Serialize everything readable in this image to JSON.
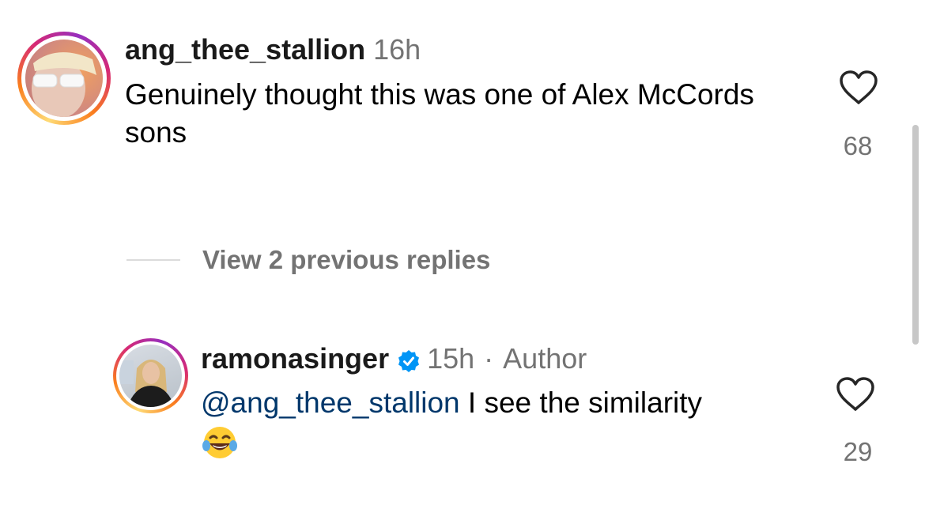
{
  "comments": [
    {
      "username": "ang_thee_stallion",
      "time": "16h",
      "text": "Genuinely thought this was one of Alex McCords sons",
      "likes": "68",
      "avatar_icon": "sunglasses-woman-avatar"
    }
  ],
  "view_replies": {
    "label": "View 2 previous replies"
  },
  "reply": {
    "username": "ramonasinger",
    "verified": true,
    "time": "15h",
    "separator": "·",
    "author_label": "Author",
    "mention": "@ang_thee_stallion",
    "text": "I see the similarity",
    "emoji": "😂",
    "likes": "29",
    "avatar_icon": "blonde-woman-avatar"
  },
  "colors": {
    "mention": "#00376b",
    "meta": "#737373",
    "verified": "#0095f6",
    "ring_gradient": [
      "#feda75",
      "#fa7e1e",
      "#d62976",
      "#962fbf"
    ]
  }
}
